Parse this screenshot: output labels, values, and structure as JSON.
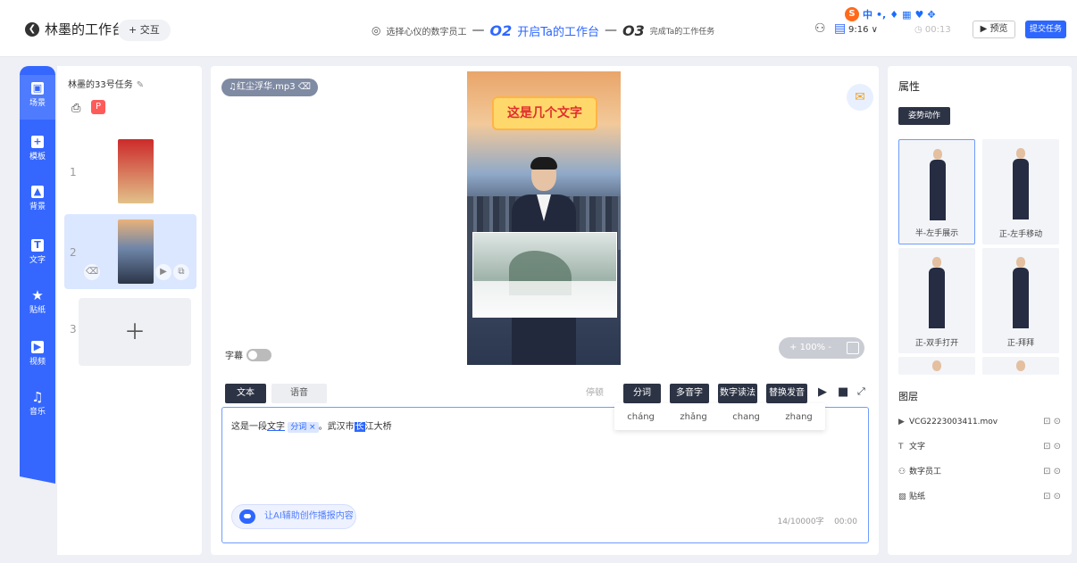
{
  "header": {
    "title": "林墨的工作台",
    "interact_label": "+ 交互",
    "step1": "选择心仪的数字员工",
    "step2_num": "O2",
    "step2": "开启Ta的工作台",
    "step3_num": "O3",
    "step3": "完成Ta的工作任务",
    "ratio": "9:16 ∨",
    "timer": "00:13",
    "preview_label": "预览",
    "submit_label": "提交任务",
    "ime_zh": "中"
  },
  "rail": {
    "items": [
      {
        "label": "场景",
        "icon": "scene-icon"
      },
      {
        "label": "模板",
        "icon": "template-icon"
      },
      {
        "label": "背景",
        "icon": "background-icon"
      },
      {
        "label": "文字",
        "icon": "text-icon"
      },
      {
        "label": "贴纸",
        "icon": "sticker-icon"
      },
      {
        "label": "视频",
        "icon": "video-icon"
      },
      {
        "label": "音乐",
        "icon": "music-icon"
      }
    ]
  },
  "scenes": {
    "task_name": "林墨的33号任务",
    "badge": "P",
    "items": [
      {
        "no": "1"
      },
      {
        "no": "2"
      },
      {
        "no": "3"
      }
    ]
  },
  "editor": {
    "audio_file": "红尘浮华.mp3",
    "banner_text": "这是几个文字",
    "zoom": "100%",
    "subtitle_label": "字幕",
    "tab_text": "文本",
    "tab_voice": "语音",
    "pause_label": "停顿",
    "btn_segment": "分词",
    "btn_polyphone": "多音字",
    "btn_number": "数字读法",
    "btn_replace": "替换发音",
    "text_pre": "这是一段",
    "text_word": "文字",
    "tag_label": "分词 ×",
    "text_mid": "。武汉市",
    "text_hl": "长",
    "text_post": "江大桥",
    "pinyin": [
      "cháng",
      "zhǎng",
      "chang",
      "zhang"
    ],
    "ai_label": "让AI辅助创作播报内容",
    "counter": "14/10000字",
    "duration": "00:00"
  },
  "props": {
    "title": "属性",
    "pose_tab": "姿势动作",
    "poses": [
      "半-左手展示",
      "正-左手移动",
      "正-双手打开",
      "正-拜拜"
    ],
    "layers_title": "图层",
    "layers": [
      {
        "name": "VCG2223003411.mov",
        "icon": "video-file-icon"
      },
      {
        "name": "文字",
        "icon": "text-icon"
      },
      {
        "name": "数字员工",
        "icon": "person-icon"
      },
      {
        "name": "贴纸",
        "icon": "image-icon"
      }
    ]
  }
}
